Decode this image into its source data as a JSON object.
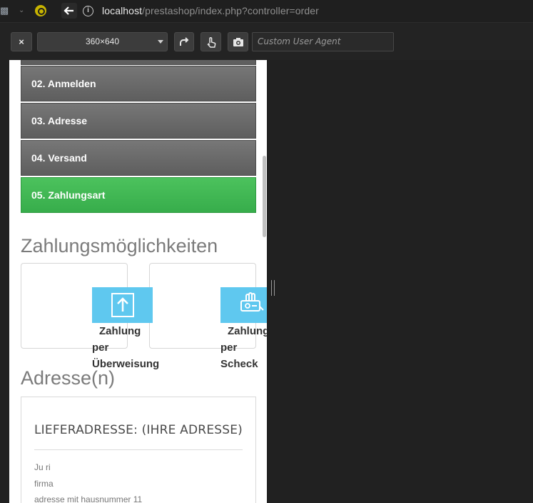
{
  "browser": {
    "url_host": "localhost",
    "url_path": "/prestashop/index.php?controller=order",
    "icons": [
      "extension-icon",
      "chevron-down-icon",
      "extension-search-icon",
      "back-arrow-icon",
      "info-icon"
    ]
  },
  "devtools": {
    "close_label": "×",
    "device_size": "360×640",
    "ua_placeholder": "Custom User Agent",
    "icons": [
      "rotate-icon",
      "touch-icon",
      "camera-icon"
    ]
  },
  "checkout": {
    "steps": [
      {
        "label": ""
      },
      {
        "label": "02. Anmelden"
      },
      {
        "label": "03. Adresse"
      },
      {
        "label": "04. Versand"
      },
      {
        "label": "05. Zahlungsart"
      }
    ],
    "active_step_color": "#3cb553",
    "payment_title": "Zahlungsmöglichkeiten",
    "payment_options": [
      {
        "icon": "upload-arrow-icon",
        "line1": "Zahlung",
        "line2": "per",
        "line3": "Überweisung"
      },
      {
        "icon": "check-payment-icon",
        "line1": "Zahlung",
        "line2": "per",
        "line3": "Scheck"
      }
    ],
    "address_title": "Adresse(n)",
    "address": {
      "heading": "LIEFERADRESSE: (IHRE ADRESSE)",
      "lines": [
        "Ju ri",
        "firma",
        "adresse mit hausnummer 11"
      ]
    }
  },
  "colors": {
    "accent_blue": "#5fc8ef",
    "step_grey": "#6a6a6a"
  }
}
